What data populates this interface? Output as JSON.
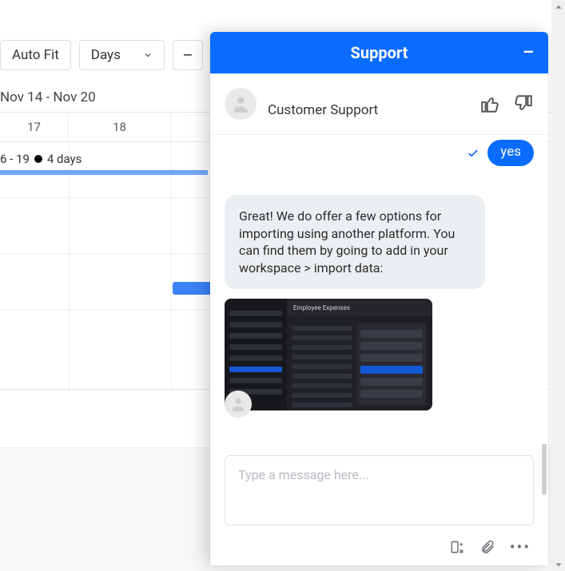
{
  "calendar": {
    "toolbar": {
      "autofit_label": "Auto Fit",
      "granularity_label": "Days",
      "zoom_out_label": "–"
    },
    "date_range": "Nov 14 - Nov 20",
    "columns": [
      "17",
      "18"
    ],
    "task_summary_prefix": "6 - 19",
    "task_duration": "4 days"
  },
  "chat": {
    "header_title": "Support",
    "minimize_glyph": "–",
    "agent_name": "Customer Support",
    "user_reply": "yes",
    "agent_message": "Great! We do offer a few options for importing using another platform. You can find them by going to add in your workspace > import data:",
    "screenshot_title": "Employee Expenses",
    "input_placeholder": "Type a message here...",
    "icons": {
      "thumbs_up": "thumbs-up-icon",
      "thumbs_down": "thumbs-down-icon",
      "send_other": "popout-icon",
      "attach": "paperclip-icon",
      "more": "more-icon"
    }
  }
}
